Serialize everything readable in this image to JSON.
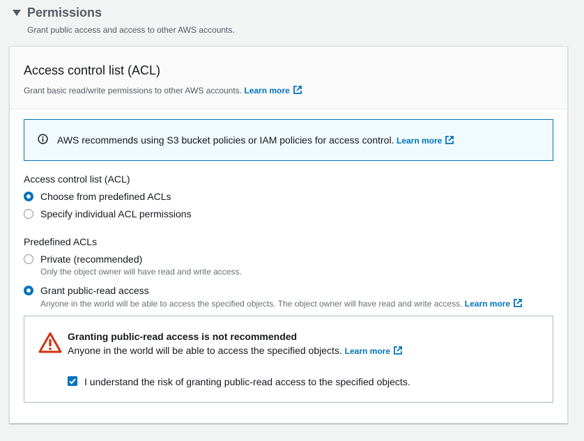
{
  "section": {
    "title": "Permissions",
    "subtitle": "Grant public access and access to other AWS accounts."
  },
  "acl_panel": {
    "title": "Access control list (ACL)",
    "description": "Grant basic read/write permissions to other AWS accounts.",
    "learn_more": "Learn more"
  },
  "info": {
    "text": "AWS recommends using S3 bucket policies or IAM policies for access control.",
    "learn_more": "Learn more"
  },
  "acl_choice": {
    "label": "Access control list (ACL)",
    "options": [
      {
        "label": "Choose from predefined ACLs",
        "checked": true
      },
      {
        "label": "Specify individual ACL permissions",
        "checked": false
      }
    ]
  },
  "predefined": {
    "label": "Predefined ACLs",
    "options": [
      {
        "label": "Private (recommended)",
        "description": "Only the object owner will have read and write access.",
        "checked": false
      },
      {
        "label": "Grant public-read access",
        "description": "Anyone in the world will be able to access the specified objects. The object owner will have read and write access.",
        "learn_more": "Learn more",
        "checked": true
      }
    ]
  },
  "warning": {
    "title": "Granting public-read access is not recommended",
    "text": "Anyone in the world will be able to access the specified objects.",
    "learn_more": "Learn more",
    "checkbox_label": "I understand the risk of granting public-read access to the specified objects.",
    "checkbox_checked": true
  },
  "colors": {
    "link": "#0073bb",
    "info_bg": "#f1faff",
    "warning_icon": "#d13212",
    "page_bg": "#f2f3f3"
  },
  "icons": [
    "caret-down-icon",
    "external-link-icon",
    "info-icon",
    "warning-icon",
    "checkmark-icon"
  ]
}
